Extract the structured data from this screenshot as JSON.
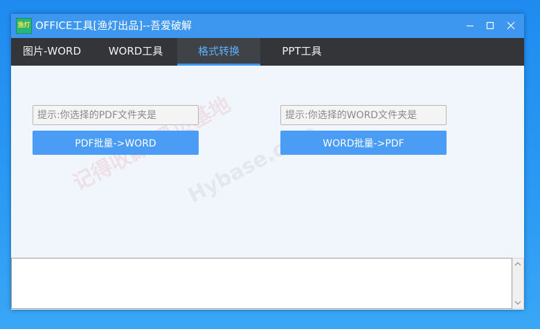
{
  "window": {
    "title": "OFFICE工具[渔灯出品]--吾爱破解",
    "icon_text": "渔灯",
    "accent_color": "#3d97ef",
    "controls": [
      "minimize-icon",
      "maximize-icon",
      "close-icon"
    ]
  },
  "tabs": [
    {
      "label": "图片-WORD",
      "active": false
    },
    {
      "label": "WORD工具",
      "active": false
    },
    {
      "label": "格式转换",
      "active": true
    },
    {
      "label": "PPT工具",
      "active": false
    }
  ],
  "panel": {
    "pdf_input": {
      "value": "",
      "placeholder": "提示:你选择的PDF文件夹是"
    },
    "pdf_button": "PDF批量->WORD",
    "word_input": {
      "value": "",
      "placeholder": "提示:你选择的WORD文件夹是"
    },
    "word_button": "WORD批量->PDF"
  },
  "watermark": {
    "line1": "记得收藏:黑贝基地",
    "line2": "Hybase.com"
  },
  "log": {
    "value": ""
  }
}
